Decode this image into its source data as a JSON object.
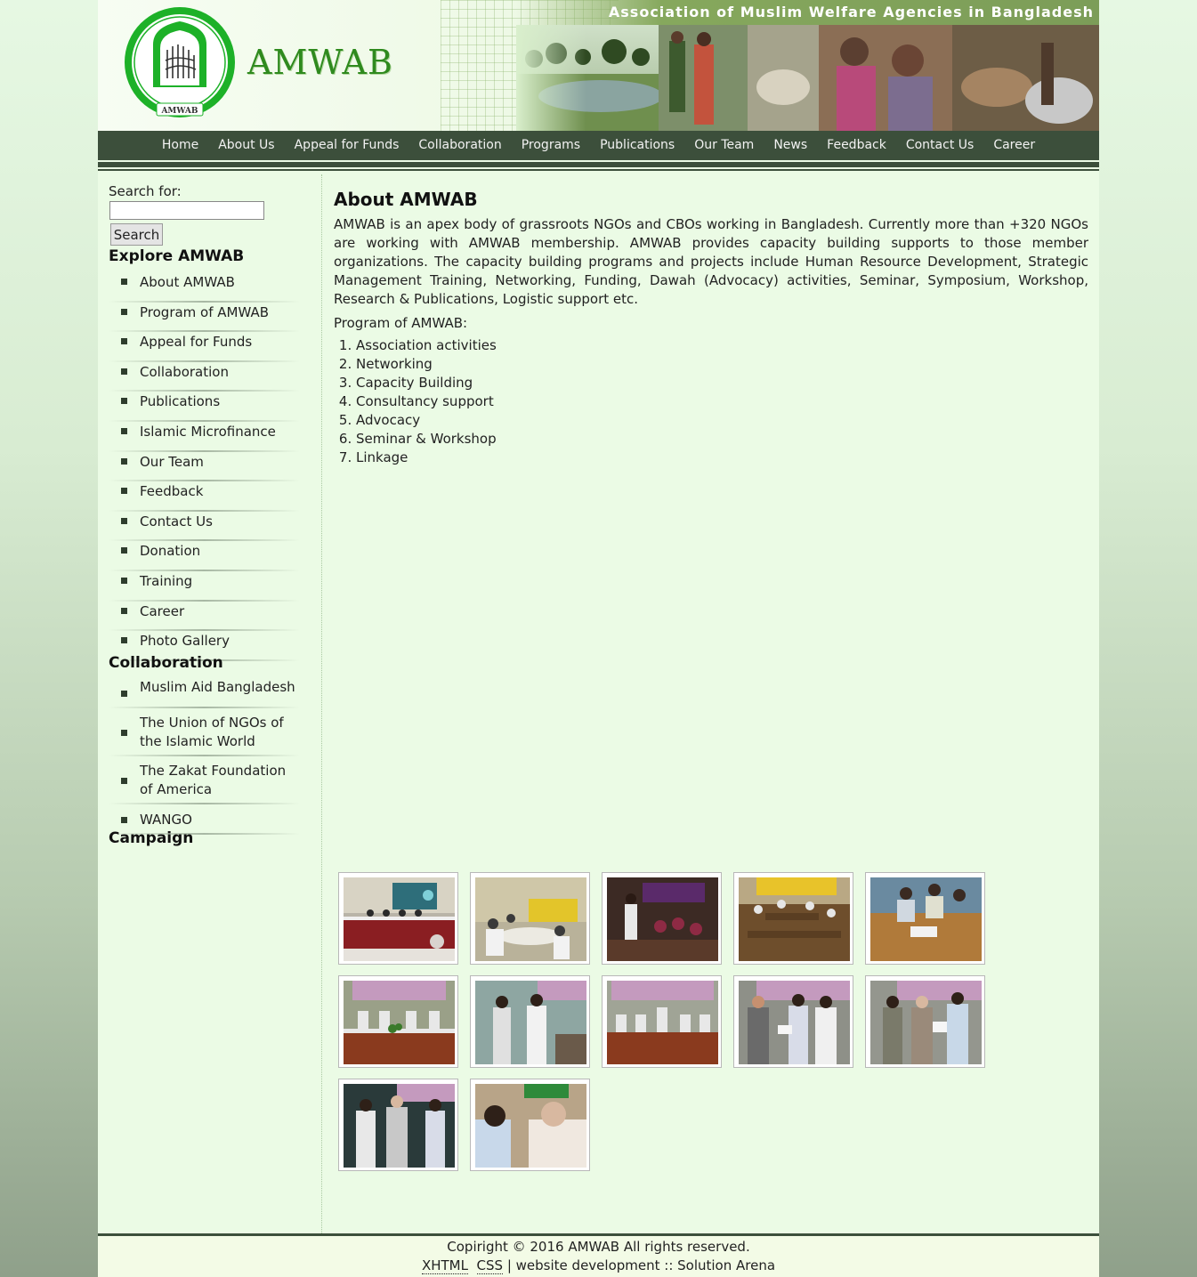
{
  "header": {
    "logo_text": "AMWAB",
    "emblem_caption": "AMWAB",
    "tagline": "Association of Muslim Welfare Agencies in Bangladesh"
  },
  "nav": {
    "items": [
      "Home",
      "About Us",
      "Appeal for Funds",
      "Collaboration",
      "Programs",
      "Publications",
      "Our Team",
      "News",
      "Feedback",
      "Contact Us",
      "Career"
    ]
  },
  "sidebar": {
    "search_label": "Search for:",
    "search_value": "",
    "search_button": "Search",
    "explore_heading": "Explore AMWAB",
    "explore_items": [
      "About AMWAB",
      "Program of AMWAB",
      "Appeal for Funds",
      "Collaboration",
      "Publications",
      "Islamic Microfinance",
      "Our Team",
      "Feedback",
      "Contact Us",
      "Donation",
      "Training",
      "Career",
      "Photo Gallery"
    ],
    "collab_heading": "Collaboration",
    "collab_items": [
      "Muslim Aid Bangladesh",
      "The Union of NGOs of the Islamic World",
      "The Zakat Foundation of America",
      "WANGO"
    ],
    "campaign_heading": "Campaign"
  },
  "main": {
    "title": "About AMWAB",
    "intro": "AMWAB is an apex body  of grassroots NGOs and CBOs working in Bangladesh. Currently more than +320 NGOs are working with AMWAB membership. AMWAB provides capacity building supports to those member organizations. The capacity building programs and projects include Human Resource Development, Strategic Management Training, Networking, Funding, Dawah (Advocacy) activities, Seminar, Symposium, Workshop, Research & Publications, Logistic support etc.",
    "program_label": "Program of AMWAB:",
    "programs": [
      "Association activities",
      "Networking",
      "Capacity Building",
      "Consultancy support",
      "Advocacy",
      "Seminar & Workshop",
      "Linkage"
    ]
  },
  "gallery": {
    "count": 12
  },
  "footer": {
    "copyright": "Copiright © 2016 AMWAB All rights reserved.",
    "xhtml": "XHTML",
    "css": "CSS",
    "credit": "| website development :: Solution Arena"
  }
}
